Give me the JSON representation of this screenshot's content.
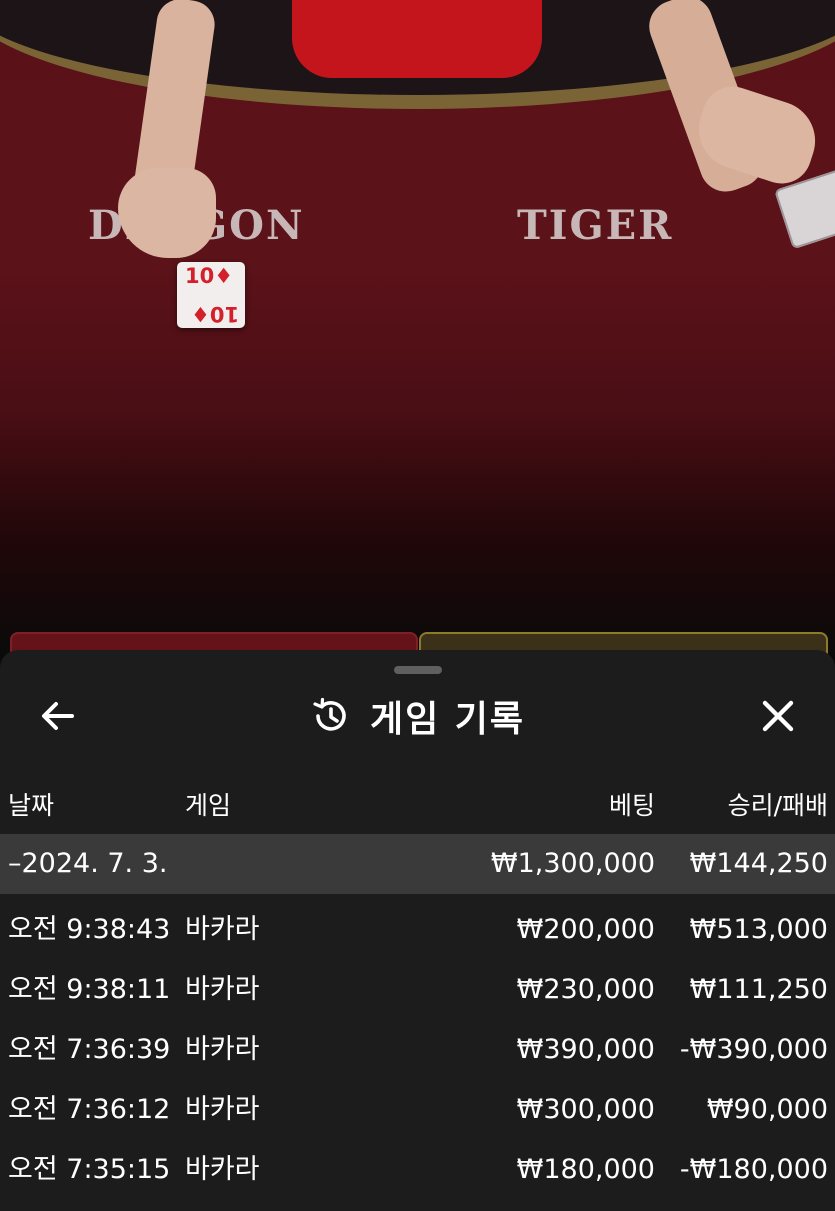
{
  "video": {
    "label_dragon": "DRAGON",
    "label_tiger": "TIGER",
    "card_rank": "10",
    "card_suit": "♦"
  },
  "sheet": {
    "title": "게임 기록",
    "back_icon": "arrow-left-icon",
    "history_icon": "history-icon",
    "close_icon": "close-icon",
    "columns": {
      "date": "날짜",
      "game": "게임",
      "bet": "베팅",
      "result": "승리/패배"
    },
    "group": {
      "date": "–2024. 7. 3.",
      "bet": "₩1,300,000",
      "result": "₩144,250"
    },
    "rows": [
      {
        "time": "오전 9:38:43",
        "game": "바카라",
        "bet": "₩200,000",
        "result": "₩513,000"
      },
      {
        "time": "오전 9:38:11",
        "game": "바카라",
        "bet": "₩230,000",
        "result": "₩111,250"
      },
      {
        "time": "오전 7:36:39",
        "game": "바카라",
        "bet": "₩390,000",
        "result": "-₩390,000"
      },
      {
        "time": "오전 7:36:12",
        "game": "바카라",
        "bet": "₩300,000",
        "result": "₩90,000"
      },
      {
        "time": "오전 7:35:15",
        "game": "바카라",
        "bet": "₩180,000",
        "result": "-₩180,000"
      }
    ]
  },
  "colors": {
    "sheet_bg": "#1c1c1c",
    "group_row_bg": "#3a3a3a",
    "table_felt": "#5a1118",
    "text": "#ffffff"
  }
}
